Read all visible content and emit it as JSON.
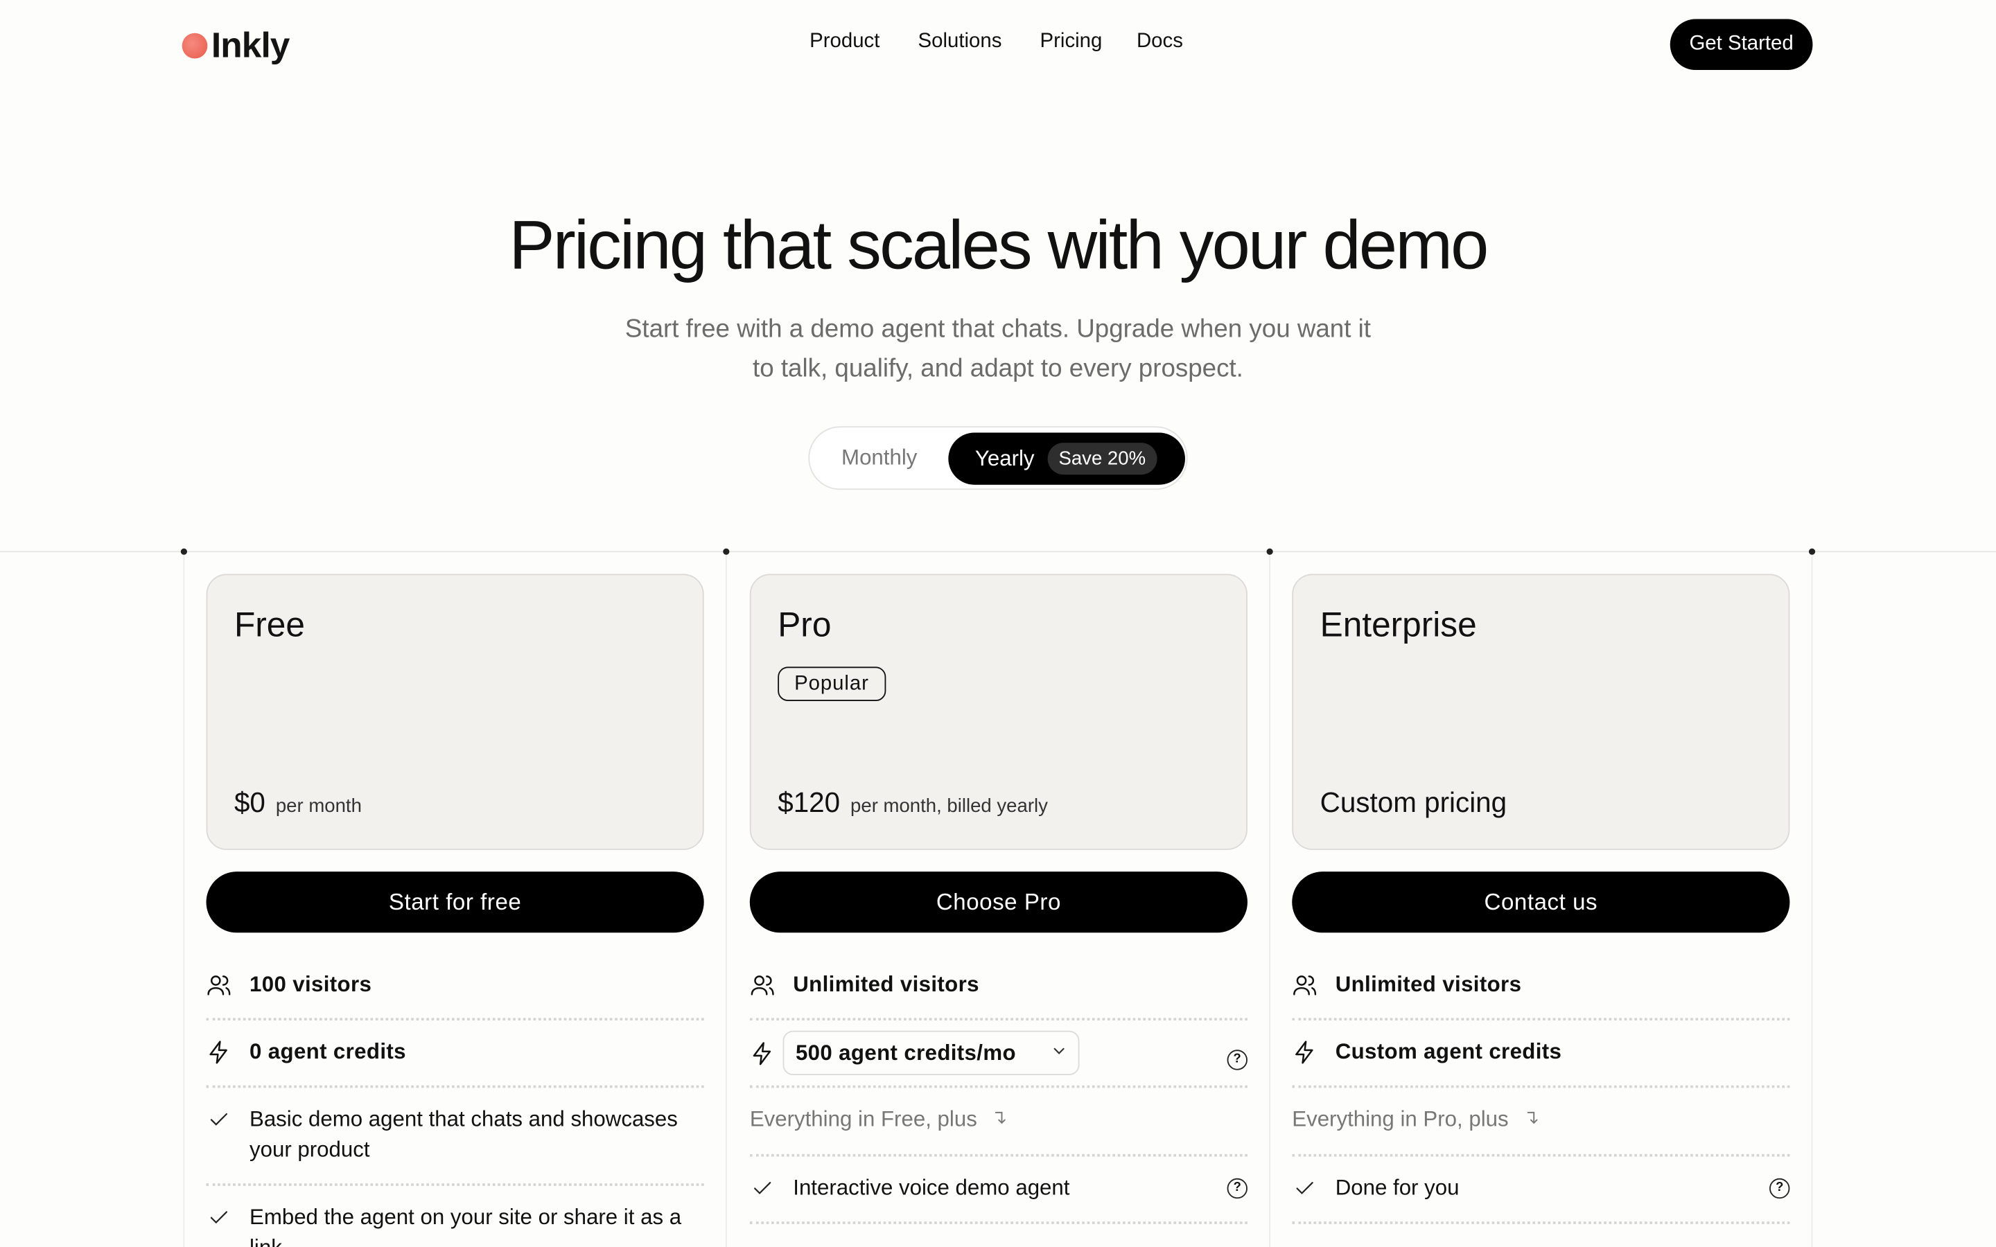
{
  "header": {
    "logo_text": "Inkly",
    "nav": [
      "Product",
      "Solutions",
      "Pricing",
      "Docs"
    ],
    "cta": "Get Started"
  },
  "hero": {
    "title": "Pricing that scales with your demo",
    "subtitle_line1": "Start free with a demo agent that chats. Upgrade when you want it",
    "subtitle_line2": "to talk, qualify, and adapt to every prospect."
  },
  "billing_toggle": {
    "monthly": "Monthly",
    "yearly": "Yearly",
    "save_badge": "Save 20%",
    "selected": "Yearly"
  },
  "plans": [
    {
      "name": "Free",
      "price": "$0",
      "price_suffix": "per month",
      "cta": "Start for free",
      "features": [
        "100 visitors",
        "0 agent credits",
        "Basic demo agent that chats and showcases your product",
        "Embed the agent on your site or share it as a link"
      ]
    },
    {
      "name": "Pro",
      "badge": "Popular",
      "price": "$120",
      "price_suffix": "per month, billed yearly",
      "cta": "Choose Pro",
      "features": [
        "Unlimited visitors",
        "500 agent credits/mo",
        "Everything in Free, plus",
        "Interactive voice demo agent"
      ]
    },
    {
      "name": "Enterprise",
      "price_text": "Custom pricing",
      "cta": "Contact us",
      "features": [
        "Unlimited visitors",
        "Custom agent credits",
        "Everything in Pro, plus",
        "Done for you"
      ]
    }
  ],
  "icons": {
    "users": "users-icon",
    "bolt": "bolt-icon",
    "check": "check-icon",
    "help": "help-circle-icon",
    "arrow": "corner-down-right-icon",
    "chevron": "chevron-down-icon"
  }
}
